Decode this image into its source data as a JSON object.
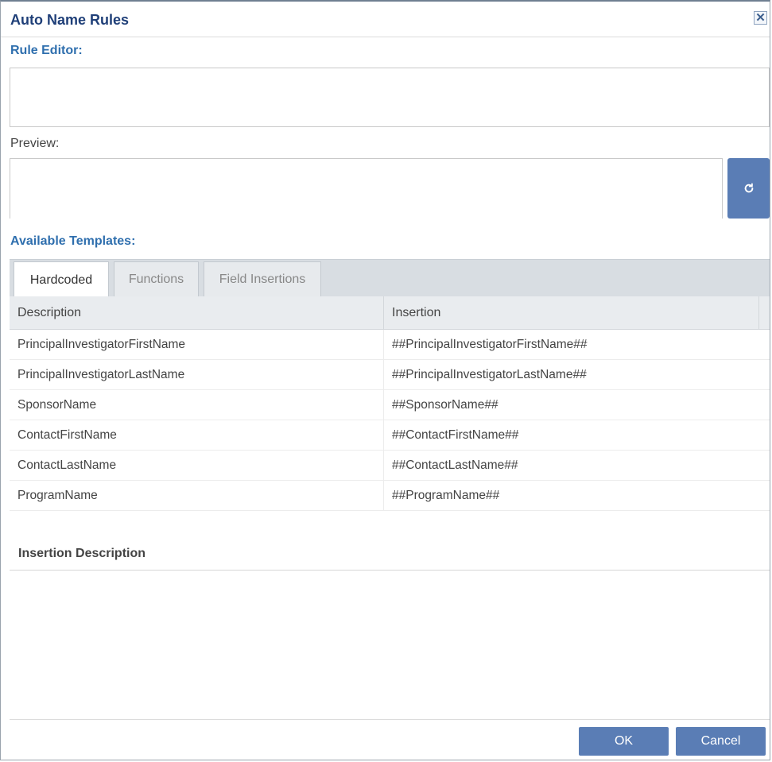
{
  "dialog": {
    "title": "Auto Name Rules",
    "close_glyph": "✕"
  },
  "rule_editor": {
    "label": "Rule Editor:",
    "value": ""
  },
  "preview": {
    "label": "Preview:",
    "value": "",
    "refresh_icon": "refresh-icon"
  },
  "templates": {
    "label": "Available Templates:",
    "tabs": [
      {
        "label": "Hardcoded",
        "active": true
      },
      {
        "label": "Functions",
        "active": false
      },
      {
        "label": "Field Insertions",
        "active": false
      }
    ],
    "columns": [
      "Description",
      "Insertion"
    ],
    "rows": [
      {
        "description": "PrincipalInvestigatorFirstName",
        "insertion": "##PrincipalInvestigatorFirstName##"
      },
      {
        "description": "PrincipalInvestigatorLastName",
        "insertion": "##PrincipalInvestigatorLastName##"
      },
      {
        "description": "SponsorName",
        "insertion": "##SponsorName##"
      },
      {
        "description": "ContactFirstName",
        "insertion": "##ContactFirstName##"
      },
      {
        "description": "ContactLastName",
        "insertion": "##ContactLastName##"
      },
      {
        "description": "ProgramName",
        "insertion": "##ProgramName##"
      }
    ]
  },
  "insertion_description": {
    "label": "Insertion Description",
    "value": ""
  },
  "footer": {
    "ok_label": "OK",
    "cancel_label": "Cancel"
  },
  "colors": {
    "accent": "#5a7db5",
    "title": "#1f3f78",
    "section_label": "#2f6fae"
  }
}
